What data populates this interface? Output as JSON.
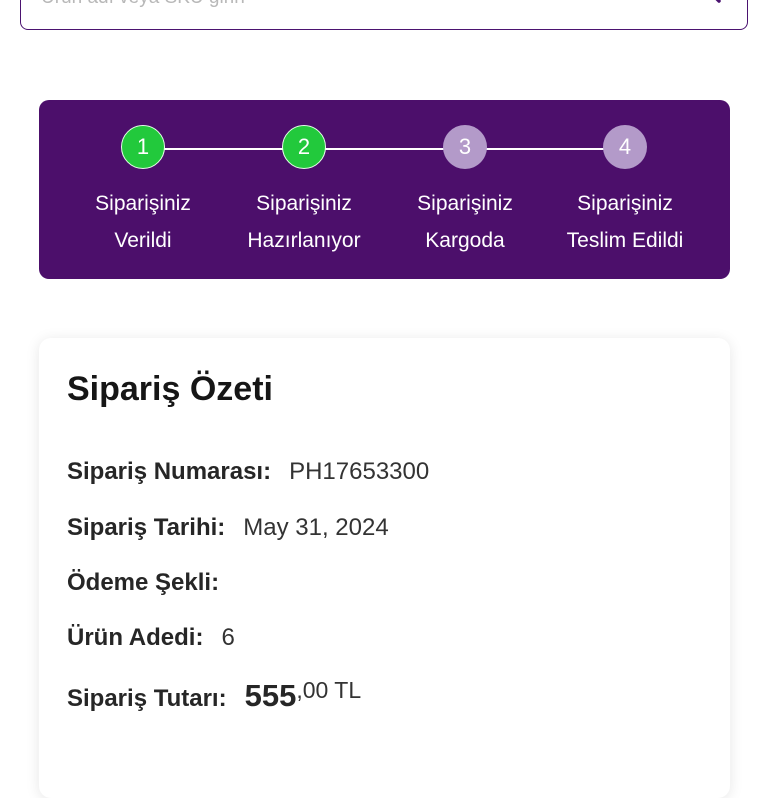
{
  "search": {
    "placeholder": "Ürün adı veya SKU girin"
  },
  "tracker": {
    "steps": [
      {
        "number": "1",
        "line1": "Siparişiniz",
        "line2": "Verildi",
        "status": "done"
      },
      {
        "number": "2",
        "line1": "Siparişiniz",
        "line2": "Hazırlanıyor",
        "status": "done"
      },
      {
        "number": "3",
        "line1": "Siparişiniz",
        "line2": "Kargoda",
        "status": "pending"
      },
      {
        "number": "4",
        "line1": "Siparişiniz",
        "line2": "Teslim Edildi",
        "status": "pending"
      }
    ]
  },
  "summary": {
    "title": "Sipariş Özeti",
    "order_number_label": "Sipariş Numarası:",
    "order_number": "PH17653300",
    "order_date_label": "Sipariş Tarihi:",
    "order_date": "May 31, 2024",
    "payment_label": "Ödeme Şekli:",
    "payment": "",
    "item_count_label": "Ürün Adedi:",
    "item_count": "6",
    "total_label": "Sipariş Tutarı:",
    "total_integer": "555",
    "total_decimal": ",00 TL"
  },
  "colors": {
    "brand_purple": "#4c0f6b",
    "step_done": "#22c93c",
    "step_pending": "#b39ac9"
  }
}
